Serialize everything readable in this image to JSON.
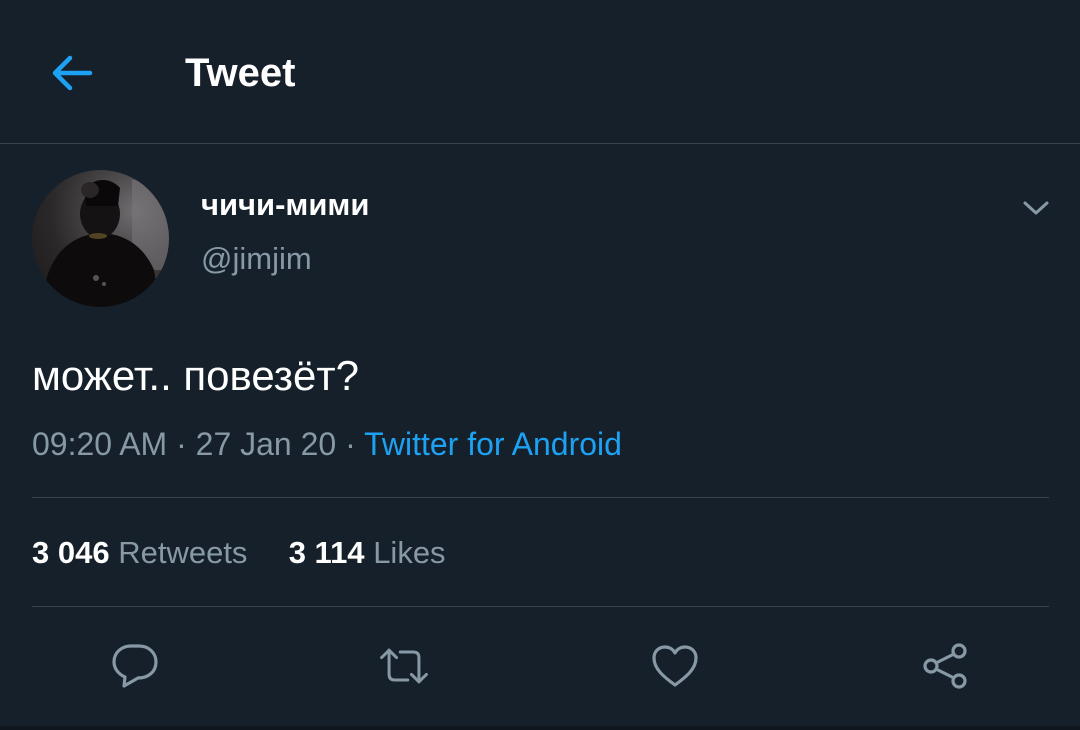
{
  "header": {
    "title": "Tweet",
    "back_icon": "arrow-left-icon",
    "accent_color": "#1da1f2"
  },
  "tweet": {
    "author": {
      "display_name": "чичи-мими",
      "handle": "@jimjim"
    },
    "text": "может.. повезёт?",
    "time": "09:20 AM",
    "date": "27 Jan 20",
    "separator": "·",
    "source": "Twitter for Android",
    "stats": {
      "retweets_count": "3 046",
      "retweets_label": "Retweets",
      "likes_count": "3 114",
      "likes_label": "Likes"
    },
    "actions": [
      "reply-icon",
      "retweet-icon",
      "like-icon",
      "share-icon"
    ]
  },
  "colors": {
    "background": "#15202b",
    "secondary_text": "#8899a6",
    "divider": "#38444d"
  }
}
